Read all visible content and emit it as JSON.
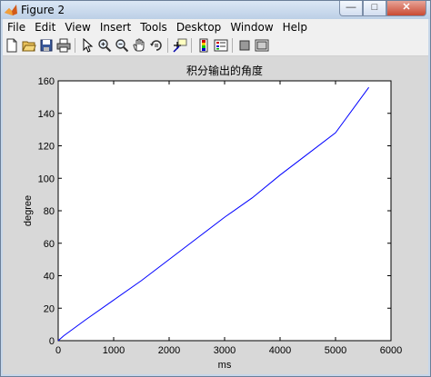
{
  "window": {
    "title": "Figure 2",
    "buttons": {
      "minimize": "—",
      "maximize": "□",
      "close": "✕"
    }
  },
  "menu": [
    "File",
    "Edit",
    "View",
    "Insert",
    "Tools",
    "Desktop",
    "Window",
    "Help"
  ],
  "toolbar": {
    "icons": [
      "new-figure-icon",
      "open-file-icon",
      "save-icon",
      "print-icon",
      "pointer-icon",
      "zoom-in-icon",
      "zoom-out-icon",
      "pan-icon",
      "rotate-icon",
      "data-cursor-icon",
      "colorbar-icon",
      "legend-icon",
      "hide-plot-tools-icon",
      "show-plot-tools-icon"
    ]
  },
  "chart_data": {
    "type": "line",
    "title": "积分输出的角度",
    "xlabel": "ms",
    "ylabel": "degree",
    "xlim": [
      0,
      6000
    ],
    "ylim": [
      0,
      160
    ],
    "xticks": [
      "0",
      "1000",
      "2000",
      "3000",
      "4000",
      "5000",
      "6000"
    ],
    "yticks": [
      "0",
      "20",
      "40",
      "60",
      "80",
      "100",
      "120",
      "140",
      "160"
    ],
    "grid": false,
    "line_color": "#0000ff",
    "series": [
      {
        "x": [
          0,
          100,
          500,
          1000,
          1500,
          2000,
          2500,
          3000,
          3500,
          4000,
          4500,
          5000,
          5600
        ],
        "y": [
          0,
          3,
          13,
          25,
          37,
          50,
          63,
          76,
          88,
          102,
          115,
          128,
          156
        ]
      }
    ]
  }
}
